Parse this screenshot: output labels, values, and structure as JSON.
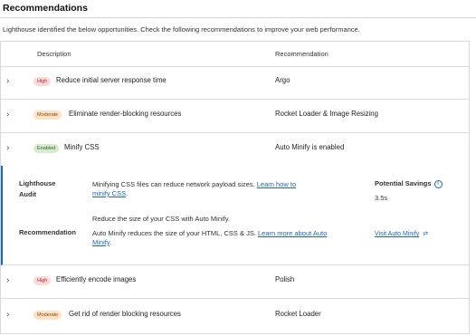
{
  "section": {
    "title": "Recommendations",
    "intro": "Lighthouse identified the below opportunities. Check the following recommendations to improve your web performance."
  },
  "table": {
    "headers": {
      "description": "Description",
      "recommendation": "Recommendation"
    },
    "rows": [
      {
        "badge": "High",
        "badge_color": "#b42b2b",
        "description": "Reduce initial server response time",
        "recommendation": "Argo"
      },
      {
        "badge": "Moderate",
        "badge_color": "#8a4a12",
        "description": "Eliminate render-blocking resources",
        "recommendation": "Rocket Loader & Image Resizing"
      },
      {
        "badge": "Enabled",
        "badge_color": "#2e6b2a",
        "description": "Minify CSS",
        "recommendation": "Auto Minify is enabled"
      },
      {
        "badge": "High",
        "badge_color": "#b42b2b",
        "description": "Efficiently encode images",
        "recommendation": "Polish"
      },
      {
        "badge": "Moderate",
        "badge_color": "#8a4a12",
        "description": "Get rid of render blocking resources",
        "recommendation": "Rocket Loader"
      }
    ]
  },
  "detail": {
    "audit_label_1": "Lighthouse",
    "audit_label_2": "Audit",
    "audit_text": "Minifying CSS files can reduce network payload sizes.",
    "audit_link_1": "Learn how to",
    "audit_link_2": "minify CSS",
    "audit_period": ".",
    "recommendation_label": "Recommendation",
    "rec_text_1": "Reduce the size of your CSS with Auto Minify.",
    "rec_text_2": "Auto Minify reduces the size of your HTML, CSS & JS.",
    "rec_link_1": "Learn more about Auto",
    "rec_link_2": "Minify",
    "rec_period": ".",
    "potential_savings_label": "Potential Savings",
    "potential_savings_value": "3.5s",
    "visit_link": "Visit Auto Minify",
    "accent_color": "#1f64b6"
  }
}
